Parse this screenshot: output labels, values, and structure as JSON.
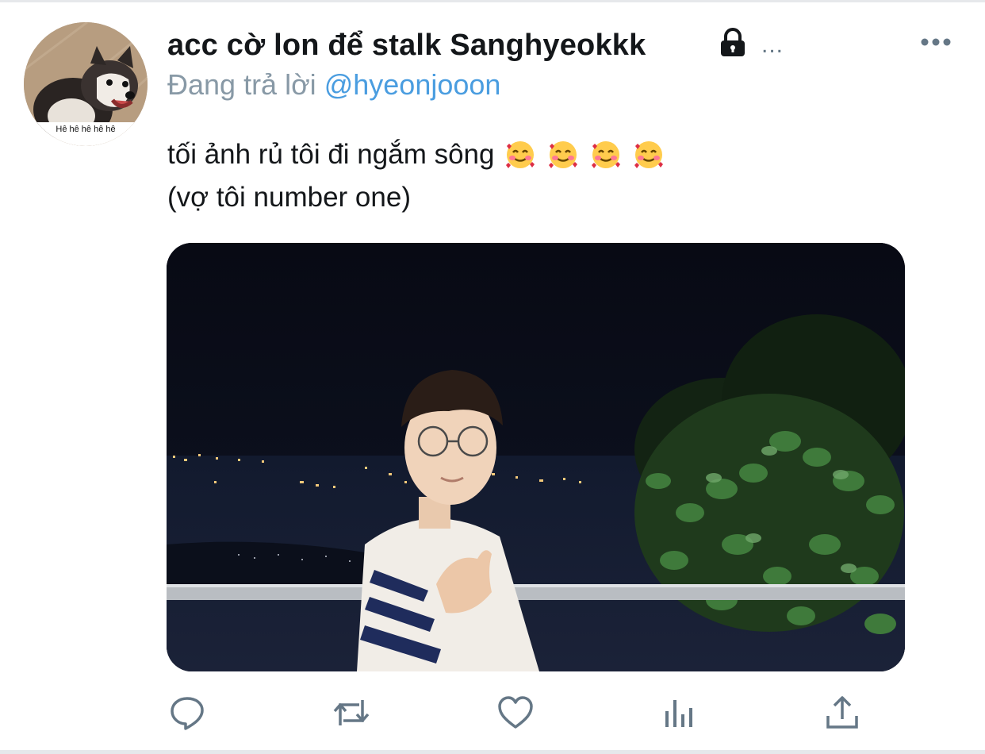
{
  "tweet": {
    "display_name": "acc cờ lon để stalk Sanghyeokkk",
    "name_overflow": "...",
    "protected_icon": "lock-icon",
    "reply_prefix": "Đang trả lời",
    "reply_handle": "@hyeonjooon",
    "text_line1": "tối ảnh rủ tôi đi ngắm sông",
    "text_line2": "(vợ tôi number one)",
    "emoji": [
      "smiling-face-with-hearts",
      "smiling-face-with-hearts",
      "smiling-face-with-hearts",
      "smiling-face-with-hearts"
    ],
    "media": "photo"
  },
  "avatar": {
    "caption": "Hê hê hê hê hê",
    "icon": "husky-dog-avatar"
  },
  "menu": {
    "icon": "more-horizontal-icon"
  },
  "actions": [
    {
      "name": "reply",
      "icon": "reply-icon"
    },
    {
      "name": "retweet",
      "icon": "retweet-icon"
    },
    {
      "name": "like",
      "icon": "heart-icon"
    },
    {
      "name": "analytics",
      "icon": "analytics-icon"
    },
    {
      "name": "share",
      "icon": "share-icon"
    }
  ],
  "colors": {
    "text": "#14171a",
    "secondary": "#657786",
    "link": "#4a9de0",
    "divider": "#e6e8eb"
  }
}
